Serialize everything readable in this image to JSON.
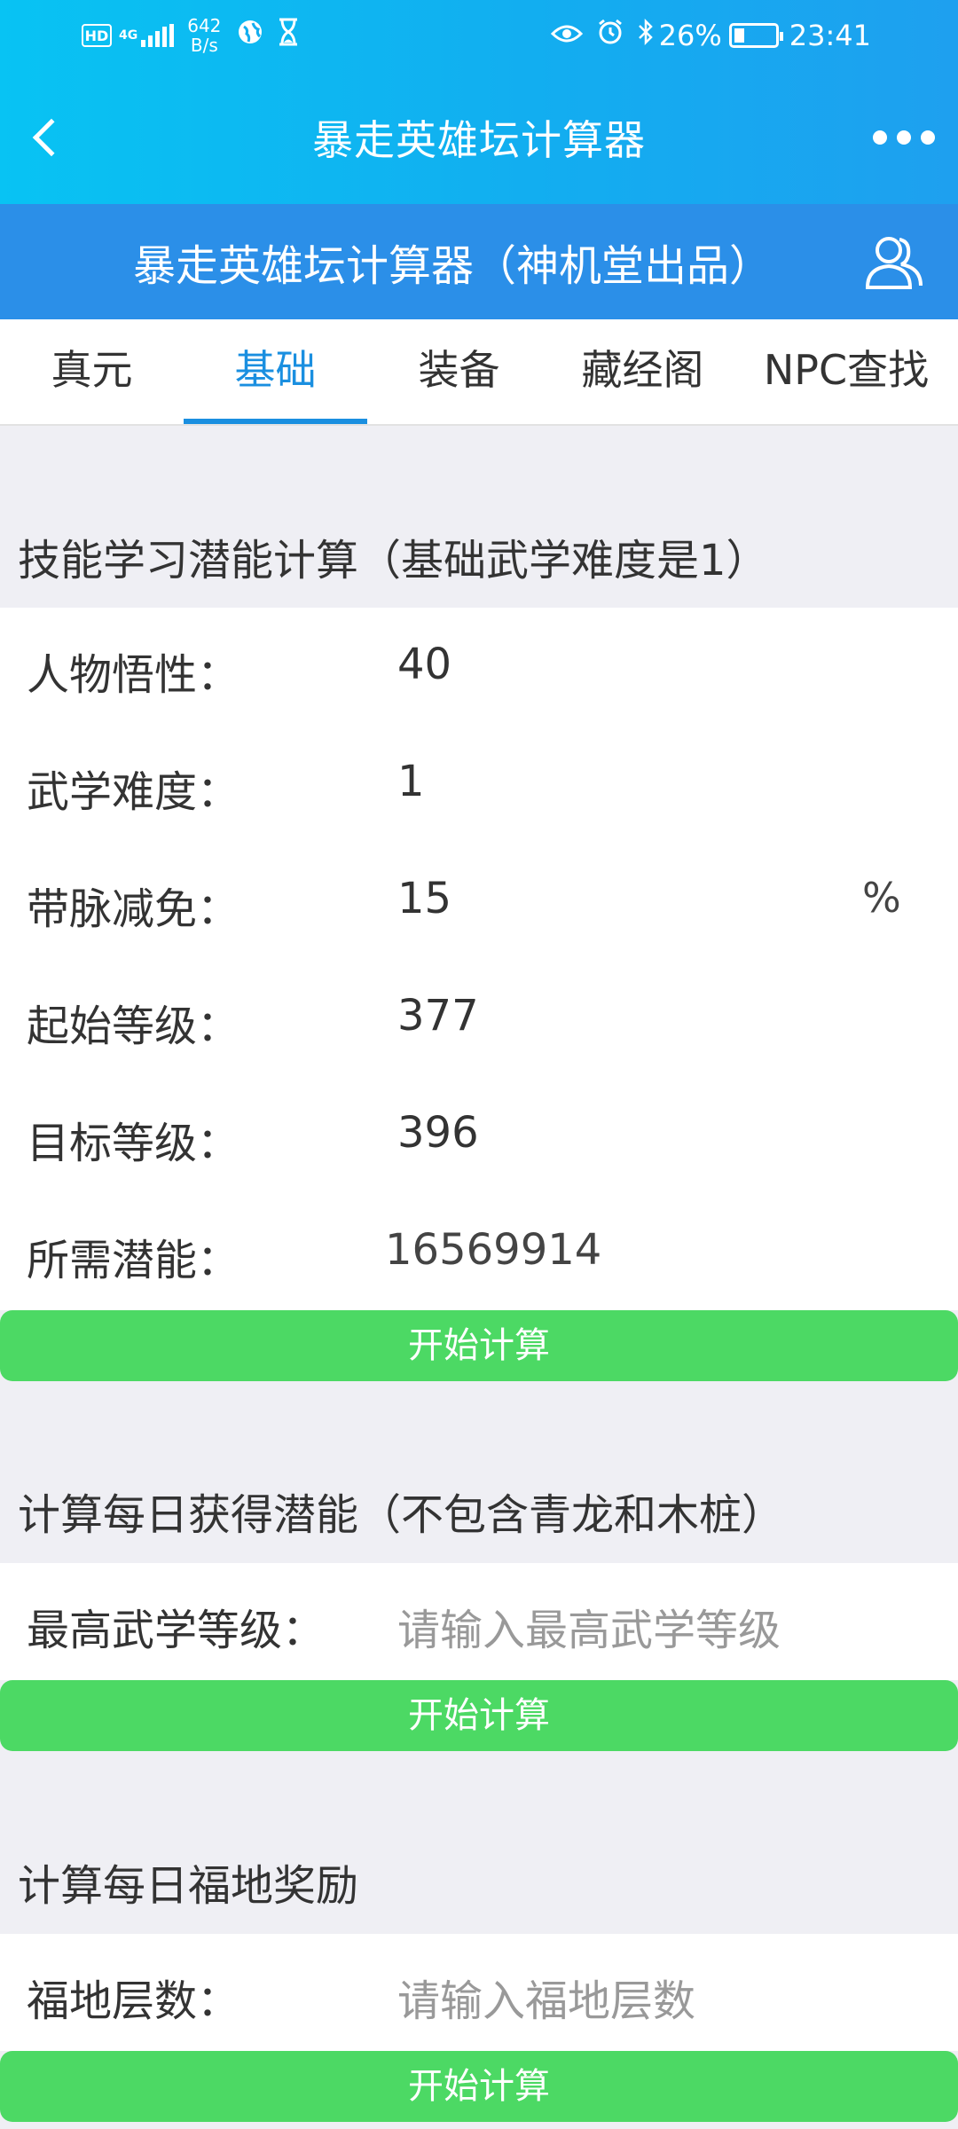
{
  "status_bar": {
    "hd": "HD",
    "network": "4G",
    "speed_value": "642",
    "speed_unit": "B/s",
    "battery_percent": "26%",
    "battery_level": 0.26,
    "time": "23:41",
    "icons": [
      "globe-icon",
      "hourglass-icon",
      "eye-icon",
      "alarm-icon",
      "bluetooth-icon"
    ]
  },
  "nav": {
    "title": "暴走英雄坛计算器"
  },
  "web_header": {
    "title": "暴走英雄坛计算器（神机堂出品）"
  },
  "tabs": [
    {
      "label": "真元",
      "active": false
    },
    {
      "label": "基础",
      "active": true
    },
    {
      "label": "装备",
      "active": false
    },
    {
      "label": "藏经阁",
      "active": false
    },
    {
      "label": "NPC查找",
      "active": false
    }
  ],
  "section1": {
    "title": "技能学习潜能计算（基础武学难度是1）",
    "rows": [
      {
        "label": "人物悟性：",
        "value": "40"
      },
      {
        "label": "武学难度：",
        "value": "1"
      },
      {
        "label": "带脉减免：",
        "value": "15",
        "unit": "%"
      },
      {
        "label": "起始等级：",
        "value": "377"
      },
      {
        "label": "目标等级：",
        "value": "396"
      },
      {
        "label": "所需潜能：",
        "value": "16569914"
      }
    ],
    "button": "开始计算"
  },
  "section2": {
    "title": "计算每日获得潜能（不包含青龙和木桩）",
    "label": "最高武学等级：",
    "placeholder": "请输入最高武学等级",
    "button": "开始计算"
  },
  "section3": {
    "title": "计算每日福地奖励",
    "label": "福地层数：",
    "placeholder": "请输入福地层数",
    "button": "开始计算"
  },
  "colors": {
    "accent": "#1a8fe0",
    "header": "#2b8fe8",
    "button": "#4cd964"
  }
}
